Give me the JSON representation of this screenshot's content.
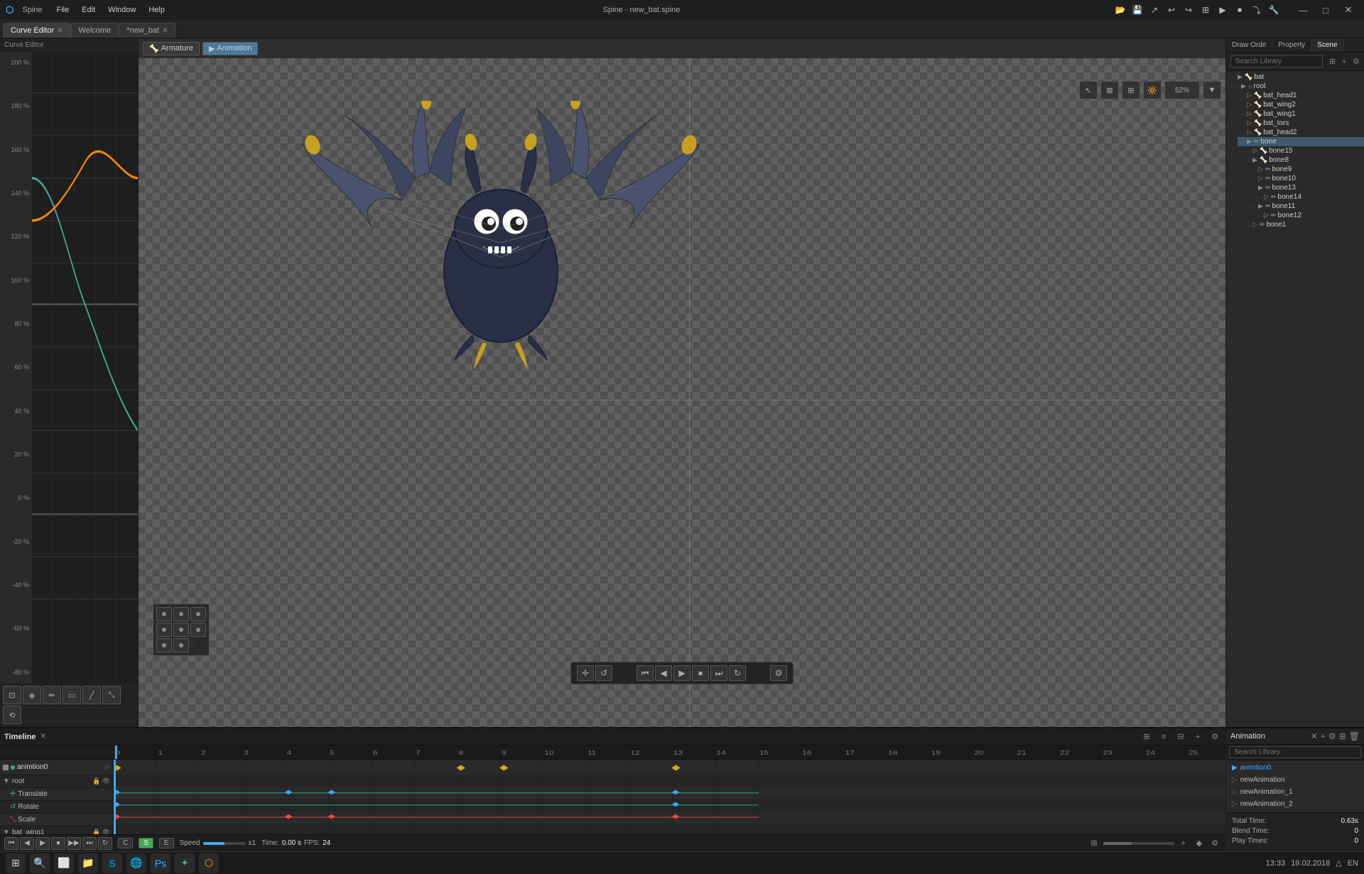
{
  "app": {
    "title": "Spine - new_bat.spine",
    "version": "Spine"
  },
  "titlebar": {
    "menus": [
      "File",
      "Edit",
      "Window",
      "Help"
    ],
    "controls": [
      "_",
      "□",
      "×"
    ]
  },
  "tabs": {
    "curve_editor": "Curve Editor",
    "welcome": "Welcome",
    "file": "*new_bat"
  },
  "viewport": {
    "mode_armature": "Armature",
    "mode_animation": "Animation",
    "zoom": "52%"
  },
  "right_panel": {
    "tabs": [
      "Draw Orde",
      "Property",
      "Scene"
    ],
    "active": "Scene",
    "search_placeholder": "Search Library",
    "bones": {
      "bat": "bat",
      "root": "root",
      "bat_head1": "bat_head1",
      "bat_wing2": "bat_wing2",
      "bat_wing1": "bat_wing1",
      "bat_tors": "bat_tors",
      "bat_head2": "bat_head2",
      "bone": "bone",
      "bone15": "bone15",
      "bone8": "bone8",
      "bone9": "bone9",
      "bone10": "bone10",
      "bone13": "bone13",
      "bone14": "bone14",
      "bone11": "bone11",
      "bone12": "bone12",
      "bone1": "bone1"
    }
  },
  "y_axis": {
    "labels": [
      "200 %",
      "180 %",
      "160 %",
      "140 %",
      "120 %",
      "100 %",
      "80 %",
      "60 %",
      "40 %",
      "20 %",
      "0 %",
      "-20 %",
      "-40 %",
      "-60 %",
      "-80 %"
    ]
  },
  "timeline": {
    "title": "Timeline",
    "tracks": [
      {
        "name": "animtion0",
        "type": "anim",
        "color": "yellow"
      },
      {
        "name": "root",
        "type": "group",
        "color": "none"
      },
      {
        "name": "Translate",
        "type": "translate",
        "color": "green"
      },
      {
        "name": "Rotate",
        "type": "rotate",
        "color": "green"
      },
      {
        "name": "Scale",
        "type": "scale",
        "color": "red"
      },
      {
        "name": "bat_wing1",
        "type": "bone",
        "color": "none"
      }
    ],
    "controls": {
      "C": "C",
      "S": "S",
      "E": "E",
      "speed_label": "Speed",
      "fps_label": "FPS:",
      "fps_value": "24",
      "time_label": "Time:",
      "time_value": "0.00 s",
      "x1": "x1"
    }
  },
  "animation_panel": {
    "title": "Animation",
    "search_placeholder": "Search Library",
    "items": [
      {
        "name": "animtion0",
        "active": true
      },
      {
        "name": "newAnimation"
      },
      {
        "name": "newAnimation_1"
      },
      {
        "name": "newAnimation_2"
      }
    ],
    "footer": {
      "total_time_label": "Total Time:",
      "total_time_value": "0.63s",
      "blend_time_label": "Blend Time:",
      "blend_time_value": "0",
      "play_times_label": "Play Times:",
      "play_times_value": "0"
    }
  }
}
